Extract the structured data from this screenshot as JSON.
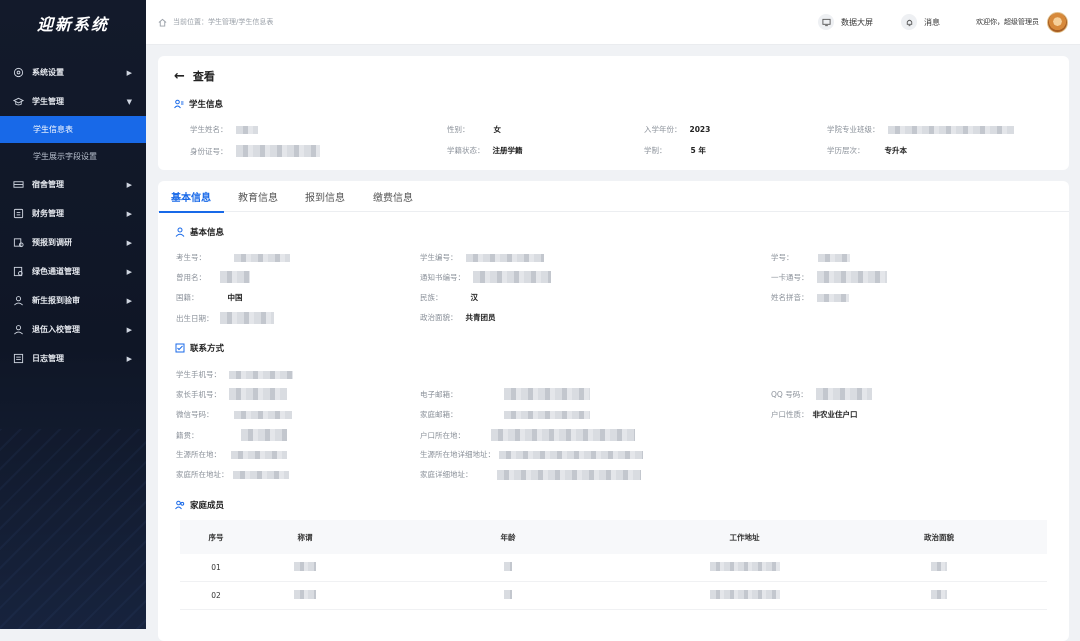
{
  "app": {
    "title": "迎新系统"
  },
  "sidebar": {
    "items": [
      {
        "label": "系统设置",
        "icon": "settings-icon"
      },
      {
        "label": "学生管理",
        "icon": "graduation-cap-icon",
        "expanded": true,
        "children": [
          {
            "label": "学生信息表",
            "active": true
          },
          {
            "label": "学生展示字段设置"
          }
        ]
      },
      {
        "label": "宿舍管理",
        "icon": "bed-icon"
      },
      {
        "label": "财务管理",
        "icon": "finance-icon"
      },
      {
        "label": "预报到调研",
        "icon": "survey-icon"
      },
      {
        "label": "绿色通道管理",
        "icon": "green-channel-icon"
      },
      {
        "label": "新生报到验审",
        "icon": "user-check-icon"
      },
      {
        "label": "退伍入校管理",
        "icon": "user-icon"
      },
      {
        "label": "日志管理",
        "icon": "log-icon"
      }
    ]
  },
  "topbar": {
    "breadcrumb": "当前位置：学生管理/学生信息表",
    "data_screen": "数据大屏",
    "messages": "消息",
    "welcome": "欢迎你，超级管理员"
  },
  "detail": {
    "back_title": "查看",
    "student_info_title": "学生信息",
    "fields": {
      "name_label": "学生姓名：",
      "gender_label": "性别：",
      "gender": "女",
      "year_label": "入学年份：",
      "year": "2023",
      "major_label": "学院专业班级：",
      "id_label": "身份证号：",
      "status_label": "学籍状态：",
      "status": "注册学籍",
      "system_label": "学制：",
      "system": "5 年",
      "level_label": "学历层次：",
      "level": "专升本"
    }
  },
  "tabs": [
    "基本信息",
    "教育信息",
    "报到信息",
    "缴费信息"
  ],
  "basic": {
    "title": "基本信息",
    "exam_no": "考生号：",
    "student_no_label": "学生编号：",
    "xuehao": "学号：",
    "former_name": "曾用名：",
    "notice_no": "通知书编号：",
    "card_no": "一卡通号：",
    "nationality_label": "国籍：",
    "nationality": "中国",
    "ethnic_label": "民族：",
    "ethnic": "汉",
    "pinyin": "姓名拼音：",
    "birth": "出生日期：",
    "political_label": "政治面貌：",
    "political": "共青团员"
  },
  "contact": {
    "title": "联系方式",
    "mobile": "学生手机号：",
    "parent_mobile": "家长手机号：",
    "email": "电子邮箱：",
    "qq": "QQ 号码：",
    "wechat": "微信号码：",
    "home_post": "家庭邮箱：",
    "hukou_type_label": "户口性质：",
    "hukou_type": "非农业住户口",
    "native": "籍贯：",
    "hukou_place": "户口所在地：",
    "source_place": "生源所在地：",
    "source_detail": "生源所在地详细地址：",
    "home_addr": "家庭所在地址：",
    "home_detail": "家庭详细地址："
  },
  "family": {
    "title": "家庭成员",
    "columns": [
      "序号",
      "称谓",
      "年龄",
      "工作地址",
      "政治面貌"
    ],
    "rows": [
      {
        "no": "01"
      },
      {
        "no": "02"
      }
    ]
  }
}
